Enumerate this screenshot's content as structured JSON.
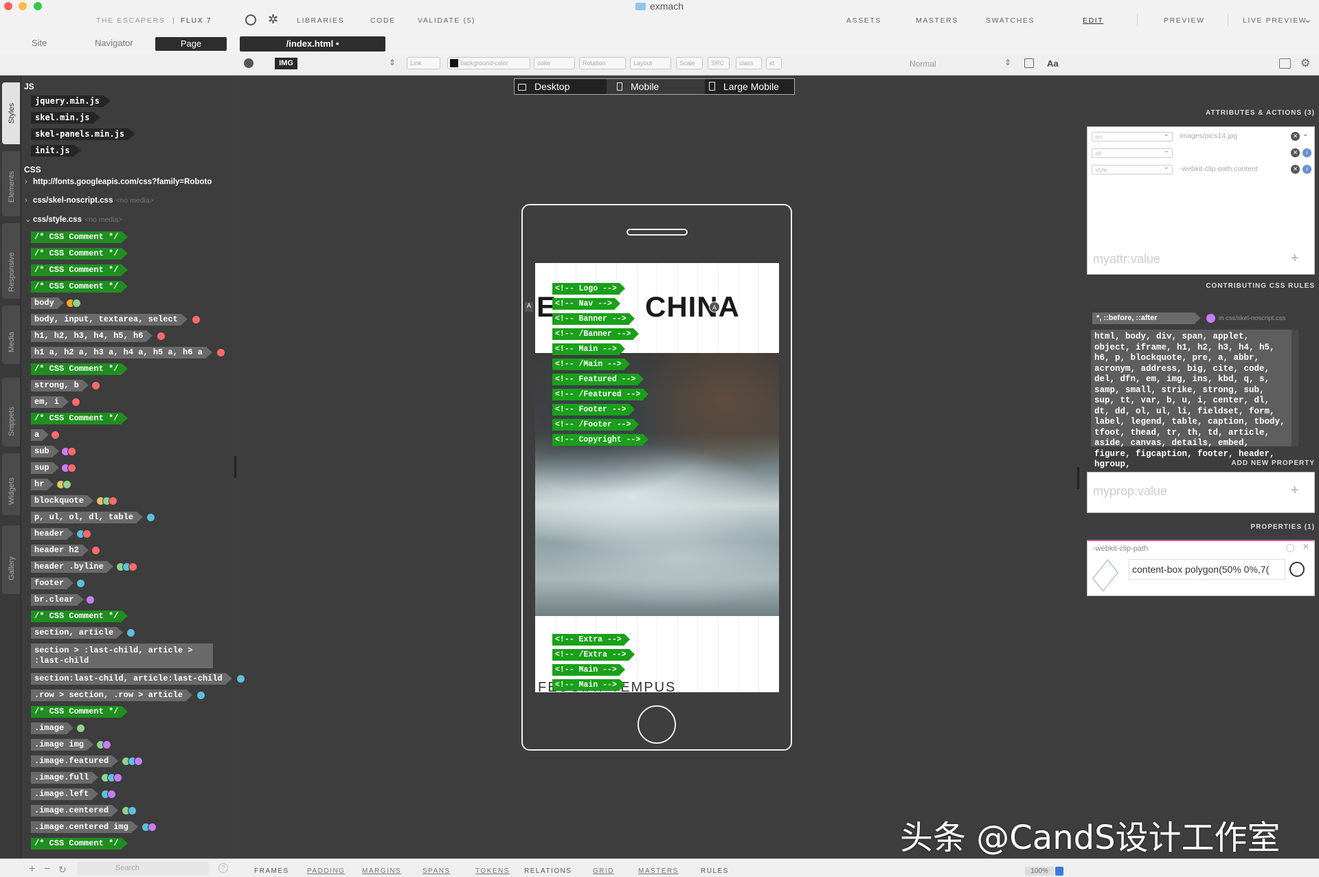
{
  "window": {
    "title": "exmach"
  },
  "nav": {
    "app": "THE ESCAPERS",
    "app_sep": "|",
    "app_version": "FLUX 7",
    "libraries": "LIBRARIES",
    "code": "CODE",
    "validate": "VALIDATE (5)",
    "assets": "ASSETS",
    "masters": "MASTERS",
    "swatches": "SWATCHES",
    "edit": "EDIT",
    "preview": "PREVIEW",
    "live_preview": "LIVE PREVIEW",
    "chevron": "⌄"
  },
  "subnav": {
    "site": "Site",
    "navigator": "Navigator",
    "page": "Page",
    "file": "/index.html •"
  },
  "toolbar": {
    "tag": "IMG",
    "link": "Link",
    "bg": "background-color",
    "color": "color",
    "rotation": "Rotation",
    "layout": "Layout",
    "scale": "Scale",
    "src": "SRC",
    "class": "class",
    "id": "id",
    "normal": "Normal",
    "aa": "Aa"
  },
  "rail": [
    "Styles",
    "Elements",
    "Responsive",
    "Media",
    "Snippets",
    "Widgets",
    "Gallery"
  ],
  "tree": {
    "js_title": "JS",
    "js": [
      "jquery.min.js",
      "skel.min.js",
      "skel-panels.min.js",
      "init.js"
    ],
    "css_title": "CSS",
    "css_files": [
      {
        "arrow": "›",
        "name": "http://fonts.googleapis.com/css?family=Roboto",
        "media": ""
      },
      {
        "arrow": "›",
        "name": "css/skel-noscript.css",
        "media": "<no media>"
      },
      {
        "arrow": "⌄",
        "name": "css/style.css",
        "media": "<no media>"
      }
    ],
    "rules": [
      {
        "t": "/* CSS Comment */",
        "c": 1,
        "d": []
      },
      {
        "t": "/* CSS Comment */",
        "c": 1,
        "d": []
      },
      {
        "t": "/* CSS Comment */",
        "c": 1,
        "d": []
      },
      {
        "t": "/* CSS Comment */",
        "c": 1,
        "d": []
      },
      {
        "t": "body",
        "c": 0,
        "d": [
          "#f5a623",
          "#8fd18f"
        ]
      },
      {
        "t": "body, input, textarea, select",
        "c": 0,
        "d": [
          "#ff6b6b"
        ]
      },
      {
        "t": "h1, h2, h3, h4, h5, h6",
        "c": 0,
        "d": [
          "#ff6b6b"
        ]
      },
      {
        "t": "h1 a, h2 a, h3 a, h4 a, h5 a, h6 a",
        "c": 0,
        "d": [
          "#ff6b6b"
        ]
      },
      {
        "t": "/* CSS Comment */",
        "c": 1,
        "d": []
      },
      {
        "t": "strong, b",
        "c": 0,
        "d": [
          "#ff6b6b"
        ]
      },
      {
        "t": "em, i",
        "c": 0,
        "d": [
          "#ff6b6b"
        ]
      },
      {
        "t": "/* CSS Comment */",
        "c": 1,
        "d": []
      },
      {
        "t": "a",
        "c": 0,
        "d": [
          "#ff6b6b"
        ]
      },
      {
        "t": "sub",
        "c": 0,
        "d": [
          "#c77dff",
          "#ff6b6b"
        ]
      },
      {
        "t": "sup",
        "c": 0,
        "d": [
          "#c77dff",
          "#ff6b6b"
        ]
      },
      {
        "t": "hr",
        "c": 0,
        "d": [
          "#e0c36a",
          "#8fd18f"
        ]
      },
      {
        "t": "blockquote",
        "c": 0,
        "d": [
          "#e0c36a",
          "#8fd18f",
          "#ff6b6b"
        ]
      },
      {
        "t": "p, ul, ol, dl, table",
        "c": 0,
        "d": [
          "#5bc0de"
        ]
      },
      {
        "t": "header",
        "c": 0,
        "d": [
          "#5bc0de",
          "#ff6b6b"
        ]
      },
      {
        "t": "header h2",
        "c": 0,
        "d": [
          "#ff6b6b"
        ]
      },
      {
        "t": "header .byline",
        "c": 0,
        "d": [
          "#8fd18f",
          "#5bc0de",
          "#ff6b6b"
        ]
      },
      {
        "t": "footer",
        "c": 0,
        "d": [
          "#5bc0de"
        ]
      },
      {
        "t": "br.clear",
        "c": 0,
        "d": [
          "#c77dff"
        ]
      },
      {
        "t": "/* CSS Comment */",
        "c": 1,
        "d": []
      },
      {
        "t": "section, article",
        "c": 0,
        "d": [
          "#5bc0de"
        ]
      },
      {
        "t": "section > :last-child, article > :last-child",
        "c": 0,
        "d": [],
        "ml": 1
      },
      {
        "t": "section:last-child, article:last-child",
        "c": 0,
        "d": [
          "#5bc0de"
        ]
      },
      {
        "t": ".row > section, .row > article",
        "c": 0,
        "d": [
          "#5bc0de"
        ]
      },
      {
        "t": "/* CSS Comment */",
        "c": 1,
        "d": []
      },
      {
        "t": ".image",
        "c": 0,
        "d": [
          "#8fd18f"
        ]
      },
      {
        "t": ".image img",
        "c": 0,
        "d": [
          "#8fd18f",
          "#c77dff"
        ]
      },
      {
        "t": ".image.featured",
        "c": 0,
        "d": [
          "#8fd18f",
          "#5bc0de",
          "#c77dff"
        ]
      },
      {
        "t": ".image.full",
        "c": 0,
        "d": [
          "#8fd18f",
          "#5bc0de",
          "#c77dff"
        ]
      },
      {
        "t": ".image.left",
        "c": 0,
        "d": [
          "#5bc0de",
          "#c77dff"
        ]
      },
      {
        "t": ".image.centered",
        "c": 0,
        "d": [
          "#8fd18f",
          "#5bc0de"
        ]
      },
      {
        "t": ".image.centered img",
        "c": 0,
        "d": [
          "#5bc0de",
          "#c77dff"
        ]
      },
      {
        "t": "/* CSS Comment */",
        "c": 1,
        "d": []
      }
    ]
  },
  "canvas": {
    "devices": [
      "Desktop",
      "Mobile",
      "Large Mobile"
    ],
    "brand": "EXMACHINA",
    "brand_partial": "E",
    "brand_tail": "CHINA",
    "footer_text": "FEUGIAT TEMPUS",
    "tags_top": [
      "<!-- Logo -->",
      "<!-- Nav -->",
      "<!-- Banner -->",
      "<!-- /Banner -->",
      "<!-- Main -->",
      "<!-- /Main -->",
      "<!-- Featured -->",
      "<!-- /Featured -->",
      "<!-- Footer -->",
      "<!-- /Footer -->",
      "<!-- Copyright -->"
    ],
    "tags_bottom": [
      "<!-- Extra -->",
      "<!-- /Extra -->",
      "<!-- Main -->",
      "<!-- Main -->"
    ]
  },
  "right": {
    "attrs_title": "ATTRIBUTES & ACTIONS (3)",
    "attrs": [
      {
        "key": "src",
        "value": "images/pics14.jpg"
      },
      {
        "key": "alt",
        "value": ""
      },
      {
        "key": "style",
        "value": "-webkit-clip-path:content"
      }
    ],
    "attr_placeholder": "myattr:value",
    "contrib_title": "CONTRIBUTING CSS RULES",
    "selector": "*, ::before, ::after",
    "selector_src": "in css/skel-noscript.css",
    "rule_text": "html, body, div, span, applet, object, iframe, h1, h2, h3, h4, h5, h6, p, blockquote, pre, a, abbr, acronym, address, big, cite, code, del, dfn, em, img, ins, kbd, q, s, samp, small, strike, strong, sub, sup, tt, var, b, u, i, center, dl, dt, dd, ol, ul, li, fieldset, form, label, legend, table, caption, tbody, tfoot, thead, tr, th, td, article, aside, canvas, details, embed, figure, figcaption, footer, header, hgroup,",
    "add_prop_title": "ADD NEW PROPERTY",
    "prop_placeholder": "myprop:value",
    "props_title": "PROPERTIES (1)",
    "prop_name": "-webkit-clip-path",
    "prop_value": "content-box polygon(50% 0%,7("
  },
  "bottom": {
    "items": [
      "FRAMES",
      "PADDING",
      "MARGINS",
      "SPANS",
      "TOKENS",
      "RELATIONS",
      "GRID",
      "MASTERS",
      "RULES"
    ],
    "search": "Search",
    "zoom": "100%"
  },
  "watermark": "头条 @CandS设计工作室",
  "colors": {
    "comment": "#1f8f1f",
    "rule": "#6a6a6a",
    "canvas_bg": "#3e3e3e"
  }
}
